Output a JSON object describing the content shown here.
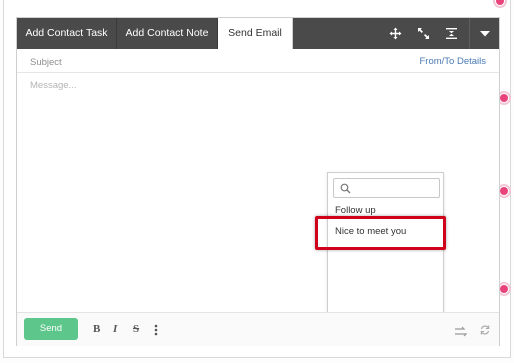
{
  "tabs": [
    {
      "label": "Add Contact Task",
      "active": false
    },
    {
      "label": "Add Contact Note",
      "active": false
    },
    {
      "label": "Send Email",
      "active": true
    }
  ],
  "toolbar_icons": [
    "move-icon",
    "expand-icon",
    "collapse-icon",
    "caret-down-icon"
  ],
  "compose": {
    "subject_placeholder": "Subject",
    "from_to_link": "From/To Details",
    "message_placeholder": "Message..."
  },
  "template_dropdown": {
    "search_placeholder": "",
    "items": [
      "Follow up",
      "Nice to meet you"
    ],
    "highlighted_item": "Nice to meet you"
  },
  "bottom_bar": {
    "send_label": "Send",
    "format_buttons": [
      "B",
      "I",
      "S"
    ],
    "right_icons": [
      "swap-icon",
      "refresh-icon"
    ]
  },
  "colors": {
    "tabbar_bg": "#4a4a4a",
    "link": "#4a7ab5",
    "send_button": "#5dc68a",
    "highlight_border": "#d0021b",
    "badge": "#e8437a"
  }
}
